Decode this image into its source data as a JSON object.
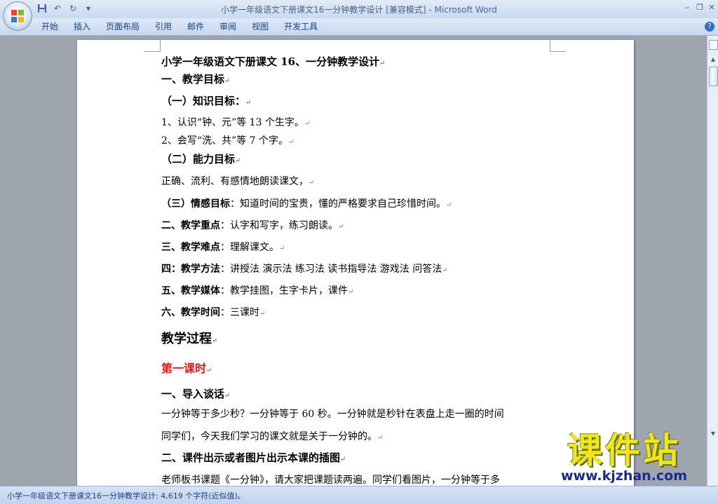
{
  "window": {
    "title_doc": "小学一年级语文下册课文16一分钟教学设计 [兼容模式]",
    "title_sep": " - ",
    "title_app": "Microsoft Word"
  },
  "quick_access": {
    "save_icon": "save-icon",
    "undo_icon": "undo-icon",
    "redo_icon": "redo-icon",
    "customize_icon": "customize-icon"
  },
  "menu": {
    "items": [
      "开始",
      "插入",
      "页面布局",
      "引用",
      "邮件",
      "审阅",
      "视图",
      "开发工具"
    ]
  },
  "document": {
    "lines": [
      {
        "bold": "小学一年级语文下册课文 16、一分钟教学设计",
        "text": "",
        "mark": "↵"
      },
      {
        "bold": "一、教学目标",
        "text": "",
        "mark": "↵"
      },
      {
        "bold": "（一）知识目标：",
        "text": "",
        "mark": "↵"
      },
      {
        "bold": "",
        "text": "1、认识“钟、元”等 13 个生字。",
        "mark": "↵"
      },
      {
        "bold": "",
        "text": "2、会写“洗、共”等 7 个字。",
        "mark": "↵"
      },
      {
        "bold": "（二）能力目标",
        "text": "",
        "mark": "↵"
      },
      {
        "bold": "",
        "text": " 正确、流利、有感情地朗读课文，",
        "mark": "↵"
      },
      {
        "bold": "（三）情感目标",
        "text": "：知道时间的宝贵，懂的严格要求自己珍惜时间。",
        "mark": "↵"
      },
      {
        "bold": "二、教学重点",
        "text": "：认字和写字，练习朗读。",
        "mark": "↵"
      },
      {
        "bold": "三、教学难点",
        "text": "：理解课文。",
        "mark": "↵"
      },
      {
        "bold": "四：教学方法",
        "text": "：讲授法 演示法  练习法  读书指导法  游戏法  问答法",
        "mark": "↵"
      },
      {
        "bold": "五、教学媒体",
        "text": "：教学挂图，生字卡片，课件",
        "mark": "↵"
      },
      {
        "bold": "六、教学时间",
        "text": "：三课时",
        "mark": "↵"
      },
      {
        "bold": "教学过程",
        "text": "",
        "mark": "↵"
      },
      {
        "bold": "第一课时",
        "text": "",
        "mark": "↵"
      },
      {
        "bold": "一、导入谈话",
        "text": "",
        "mark": "↵"
      },
      {
        "bold": "",
        "text": "一分钟等于多少秒？一分钟等于 60 秒。一分钟就是秒针在表盘上走一圈的时间",
        "mark": ""
      },
      {
        "bold": "",
        "text": "同学们，今天我们学习的课文就是关于一分钟的。",
        "mark": "↵"
      },
      {
        "bold": "二、课件出示或者图片出示本课的插图",
        "text": "",
        "mark": "↵"
      },
      {
        "bold": "",
        "text": "老师板书课题《一分钟》，请大家把课题读两遍。同学们看图片，一分钟等于多",
        "mark": ""
      }
    ]
  },
  "status": {
    "text": "小学一年级语文下册课文16一分钟教学设计: 4,619 个字符(近似值)。"
  },
  "watermark": {
    "cn": "课件站",
    "url": "www.kjzhan.com"
  }
}
